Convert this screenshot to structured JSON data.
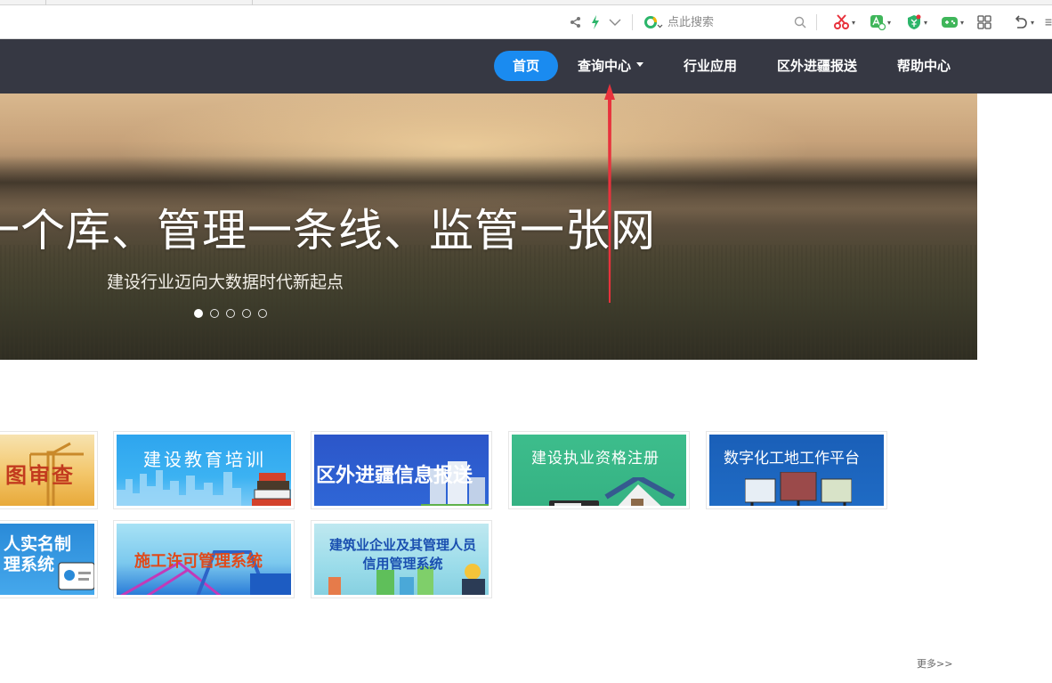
{
  "browser": {
    "search_placeholder": "点此搜索"
  },
  "nav": {
    "items": [
      {
        "label": "首页",
        "active": true
      },
      {
        "label": "查询中心",
        "has_dropdown": true
      },
      {
        "label": "行业应用"
      },
      {
        "label": "区外进疆报送"
      },
      {
        "label": "帮助中心"
      }
    ]
  },
  "hero": {
    "title": "一个库、管理一条线、监管一张网",
    "subtitle": "建设行业迈向大数据时代新起点",
    "slide_count": 5,
    "active_slide": 1
  },
  "tiles": [
    {
      "label": "图审查"
    },
    {
      "label": "建设教育培训"
    },
    {
      "label": "区外进疆信息报送"
    },
    {
      "label": "建设执业资格注册"
    },
    {
      "label": "数字化工地工作平台"
    },
    {
      "label_line1": "人实名制",
      "label_line2": "理系统"
    },
    {
      "label": "施工许可管理系统"
    },
    {
      "label_line1": "建筑业企业及其管理人员",
      "label_line2": "信用管理系统"
    }
  ],
  "more_link": "更多>>",
  "colors": {
    "nav_bg": "#363843",
    "nav_active": "#1a8bf0",
    "annotation_arrow": "#e8323c"
  }
}
